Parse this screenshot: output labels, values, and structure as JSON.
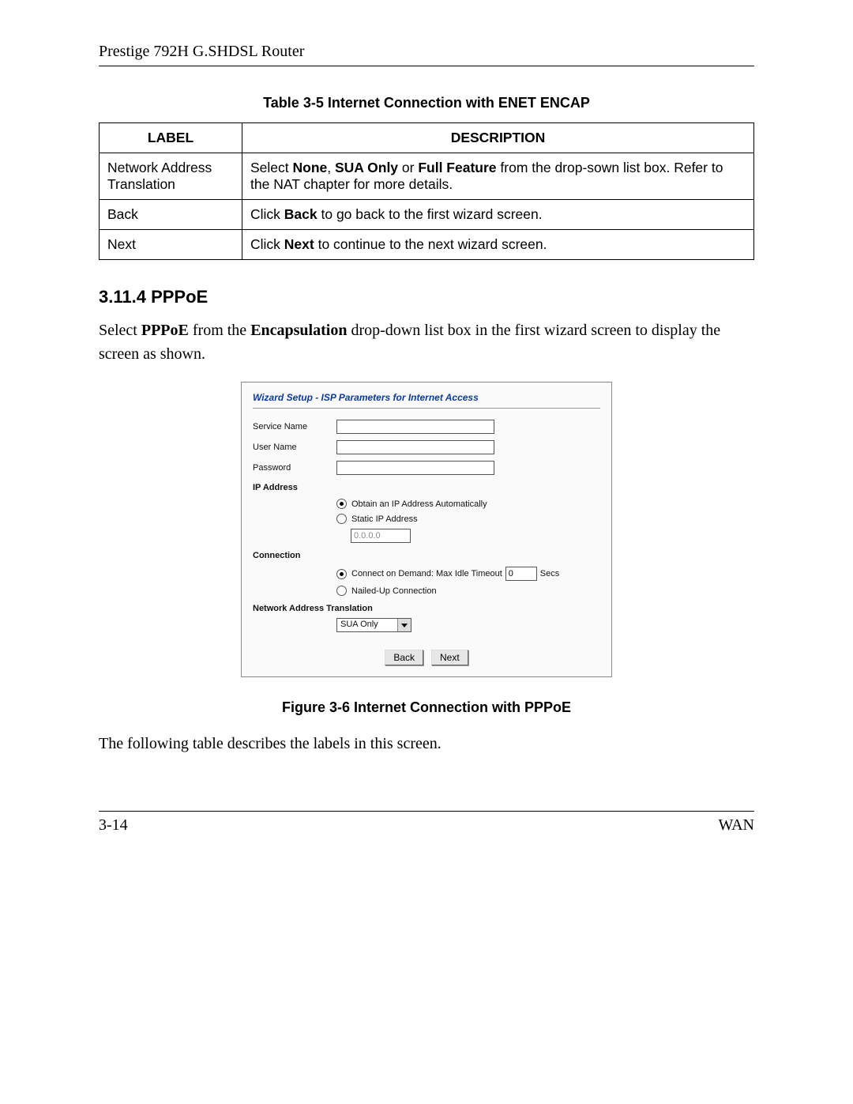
{
  "header": {
    "title": "Prestige 792H G.SHDSL Router"
  },
  "table_caption": "Table 3-5 Internet Connection with ENET ENCAP",
  "table": {
    "head": {
      "label": "LABEL",
      "desc": "DESCRIPTION"
    },
    "rows": [
      {
        "label": "Network Address Translation",
        "pre": "Select ",
        "b1": "None",
        "sep1": ", ",
        "b2": "SUA Only",
        "sep2": " or ",
        "b3": "Full Feature",
        "post": " from the drop-sown list box. Refer to the NAT chapter for more details."
      },
      {
        "label": "Back",
        "pre": "Click ",
        "b1": "Back",
        "post": " to go back to the first wizard screen."
      },
      {
        "label": "Next",
        "pre": "Click ",
        "b1": "Next",
        "post": " to continue to the next wizard screen."
      }
    ]
  },
  "section": {
    "heading": "3.11.4 PPPoE"
  },
  "paragraph1": {
    "p1": "Select ",
    "b1": "PPPoE",
    "p2": " from the ",
    "b2": "Encapsulation",
    "p3": " drop-down list box in the first wizard screen to display the screen as shown."
  },
  "wizard": {
    "title": "Wizard Setup - ISP Parameters for Internet Access",
    "labels": {
      "service_name": "Service Name",
      "user_name": "User Name",
      "password": "Password",
      "ip_address": "IP Address",
      "obtain_auto": "Obtain an IP Address Automatically",
      "static_ip": "Static IP Address",
      "static_ip_value": "0.0.0.0",
      "connection": "Connection",
      "connect_demand": "Connect on Demand: Max Idle Timeout",
      "idle_value": "0",
      "secs": "Secs",
      "nailed_up": "Nailed-Up Connection",
      "nat": "Network Address Translation",
      "nat_value": "SUA Only",
      "back": "Back",
      "next": "Next"
    }
  },
  "figure_caption": "Figure 3-6 Internet Connection with PPPoE",
  "paragraph2": "The following table describes the labels in this screen.",
  "footer": {
    "page": "3-14",
    "section": "WAN"
  }
}
